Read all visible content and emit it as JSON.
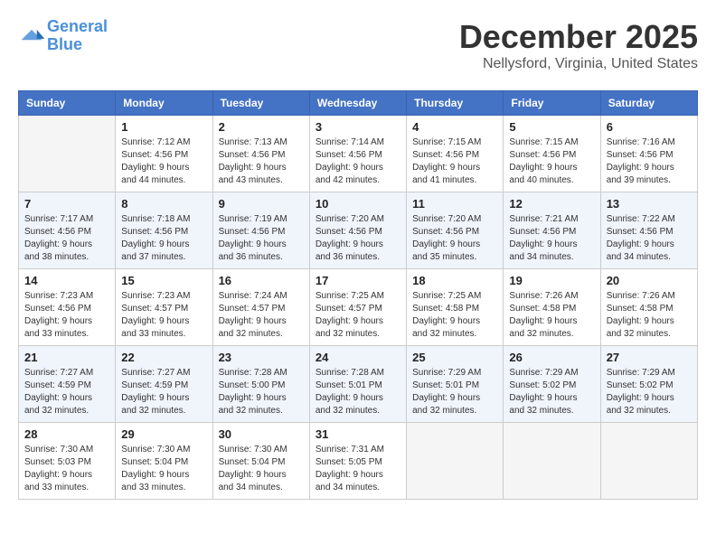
{
  "header": {
    "logo_line1": "General",
    "logo_line2": "Blue",
    "month_year": "December 2025",
    "location": "Nellysford, Virginia, United States"
  },
  "weekdays": [
    "Sunday",
    "Monday",
    "Tuesday",
    "Wednesday",
    "Thursday",
    "Friday",
    "Saturday"
  ],
  "weeks": [
    [
      {
        "day": "",
        "sunrise": "",
        "sunset": "",
        "daylight": "",
        "empty": true
      },
      {
        "day": "1",
        "sunrise": "Sunrise: 7:12 AM",
        "sunset": "Sunset: 4:56 PM",
        "daylight": "Daylight: 9 hours and 44 minutes."
      },
      {
        "day": "2",
        "sunrise": "Sunrise: 7:13 AM",
        "sunset": "Sunset: 4:56 PM",
        "daylight": "Daylight: 9 hours and 43 minutes."
      },
      {
        "day": "3",
        "sunrise": "Sunrise: 7:14 AM",
        "sunset": "Sunset: 4:56 PM",
        "daylight": "Daylight: 9 hours and 42 minutes."
      },
      {
        "day": "4",
        "sunrise": "Sunrise: 7:15 AM",
        "sunset": "Sunset: 4:56 PM",
        "daylight": "Daylight: 9 hours and 41 minutes."
      },
      {
        "day": "5",
        "sunrise": "Sunrise: 7:15 AM",
        "sunset": "Sunset: 4:56 PM",
        "daylight": "Daylight: 9 hours and 40 minutes."
      },
      {
        "day": "6",
        "sunrise": "Sunrise: 7:16 AM",
        "sunset": "Sunset: 4:56 PM",
        "daylight": "Daylight: 9 hours and 39 minutes."
      }
    ],
    [
      {
        "day": "7",
        "sunrise": "Sunrise: 7:17 AM",
        "sunset": "Sunset: 4:56 PM",
        "daylight": "Daylight: 9 hours and 38 minutes."
      },
      {
        "day": "8",
        "sunrise": "Sunrise: 7:18 AM",
        "sunset": "Sunset: 4:56 PM",
        "daylight": "Daylight: 9 hours and 37 minutes."
      },
      {
        "day": "9",
        "sunrise": "Sunrise: 7:19 AM",
        "sunset": "Sunset: 4:56 PM",
        "daylight": "Daylight: 9 hours and 36 minutes."
      },
      {
        "day": "10",
        "sunrise": "Sunrise: 7:20 AM",
        "sunset": "Sunset: 4:56 PM",
        "daylight": "Daylight: 9 hours and 36 minutes."
      },
      {
        "day": "11",
        "sunrise": "Sunrise: 7:20 AM",
        "sunset": "Sunset: 4:56 PM",
        "daylight": "Daylight: 9 hours and 35 minutes."
      },
      {
        "day": "12",
        "sunrise": "Sunrise: 7:21 AM",
        "sunset": "Sunset: 4:56 PM",
        "daylight": "Daylight: 9 hours and 34 minutes."
      },
      {
        "day": "13",
        "sunrise": "Sunrise: 7:22 AM",
        "sunset": "Sunset: 4:56 PM",
        "daylight": "Daylight: 9 hours and 34 minutes."
      }
    ],
    [
      {
        "day": "14",
        "sunrise": "Sunrise: 7:23 AM",
        "sunset": "Sunset: 4:56 PM",
        "daylight": "Daylight: 9 hours and 33 minutes."
      },
      {
        "day": "15",
        "sunrise": "Sunrise: 7:23 AM",
        "sunset": "Sunset: 4:57 PM",
        "daylight": "Daylight: 9 hours and 33 minutes."
      },
      {
        "day": "16",
        "sunrise": "Sunrise: 7:24 AM",
        "sunset": "Sunset: 4:57 PM",
        "daylight": "Daylight: 9 hours and 32 minutes."
      },
      {
        "day": "17",
        "sunrise": "Sunrise: 7:25 AM",
        "sunset": "Sunset: 4:57 PM",
        "daylight": "Daylight: 9 hours and 32 minutes."
      },
      {
        "day": "18",
        "sunrise": "Sunrise: 7:25 AM",
        "sunset": "Sunset: 4:58 PM",
        "daylight": "Daylight: 9 hours and 32 minutes."
      },
      {
        "day": "19",
        "sunrise": "Sunrise: 7:26 AM",
        "sunset": "Sunset: 4:58 PM",
        "daylight": "Daylight: 9 hours and 32 minutes."
      },
      {
        "day": "20",
        "sunrise": "Sunrise: 7:26 AM",
        "sunset": "Sunset: 4:58 PM",
        "daylight": "Daylight: 9 hours and 32 minutes."
      }
    ],
    [
      {
        "day": "21",
        "sunrise": "Sunrise: 7:27 AM",
        "sunset": "Sunset: 4:59 PM",
        "daylight": "Daylight: 9 hours and 32 minutes."
      },
      {
        "day": "22",
        "sunrise": "Sunrise: 7:27 AM",
        "sunset": "Sunset: 4:59 PM",
        "daylight": "Daylight: 9 hours and 32 minutes."
      },
      {
        "day": "23",
        "sunrise": "Sunrise: 7:28 AM",
        "sunset": "Sunset: 5:00 PM",
        "daylight": "Daylight: 9 hours and 32 minutes."
      },
      {
        "day": "24",
        "sunrise": "Sunrise: 7:28 AM",
        "sunset": "Sunset: 5:01 PM",
        "daylight": "Daylight: 9 hours and 32 minutes."
      },
      {
        "day": "25",
        "sunrise": "Sunrise: 7:29 AM",
        "sunset": "Sunset: 5:01 PM",
        "daylight": "Daylight: 9 hours and 32 minutes."
      },
      {
        "day": "26",
        "sunrise": "Sunrise: 7:29 AM",
        "sunset": "Sunset: 5:02 PM",
        "daylight": "Daylight: 9 hours and 32 minutes."
      },
      {
        "day": "27",
        "sunrise": "Sunrise: 7:29 AM",
        "sunset": "Sunset: 5:02 PM",
        "daylight": "Daylight: 9 hours and 32 minutes."
      }
    ],
    [
      {
        "day": "28",
        "sunrise": "Sunrise: 7:30 AM",
        "sunset": "Sunset: 5:03 PM",
        "daylight": "Daylight: 9 hours and 33 minutes."
      },
      {
        "day": "29",
        "sunrise": "Sunrise: 7:30 AM",
        "sunset": "Sunset: 5:04 PM",
        "daylight": "Daylight: 9 hours and 33 minutes."
      },
      {
        "day": "30",
        "sunrise": "Sunrise: 7:30 AM",
        "sunset": "Sunset: 5:04 PM",
        "daylight": "Daylight: 9 hours and 34 minutes."
      },
      {
        "day": "31",
        "sunrise": "Sunrise: 7:31 AM",
        "sunset": "Sunset: 5:05 PM",
        "daylight": "Daylight: 9 hours and 34 minutes."
      },
      {
        "day": "",
        "sunrise": "",
        "sunset": "",
        "daylight": "",
        "empty": true
      },
      {
        "day": "",
        "sunrise": "",
        "sunset": "",
        "daylight": "",
        "empty": true
      },
      {
        "day": "",
        "sunrise": "",
        "sunset": "",
        "daylight": "",
        "empty": true
      }
    ]
  ]
}
